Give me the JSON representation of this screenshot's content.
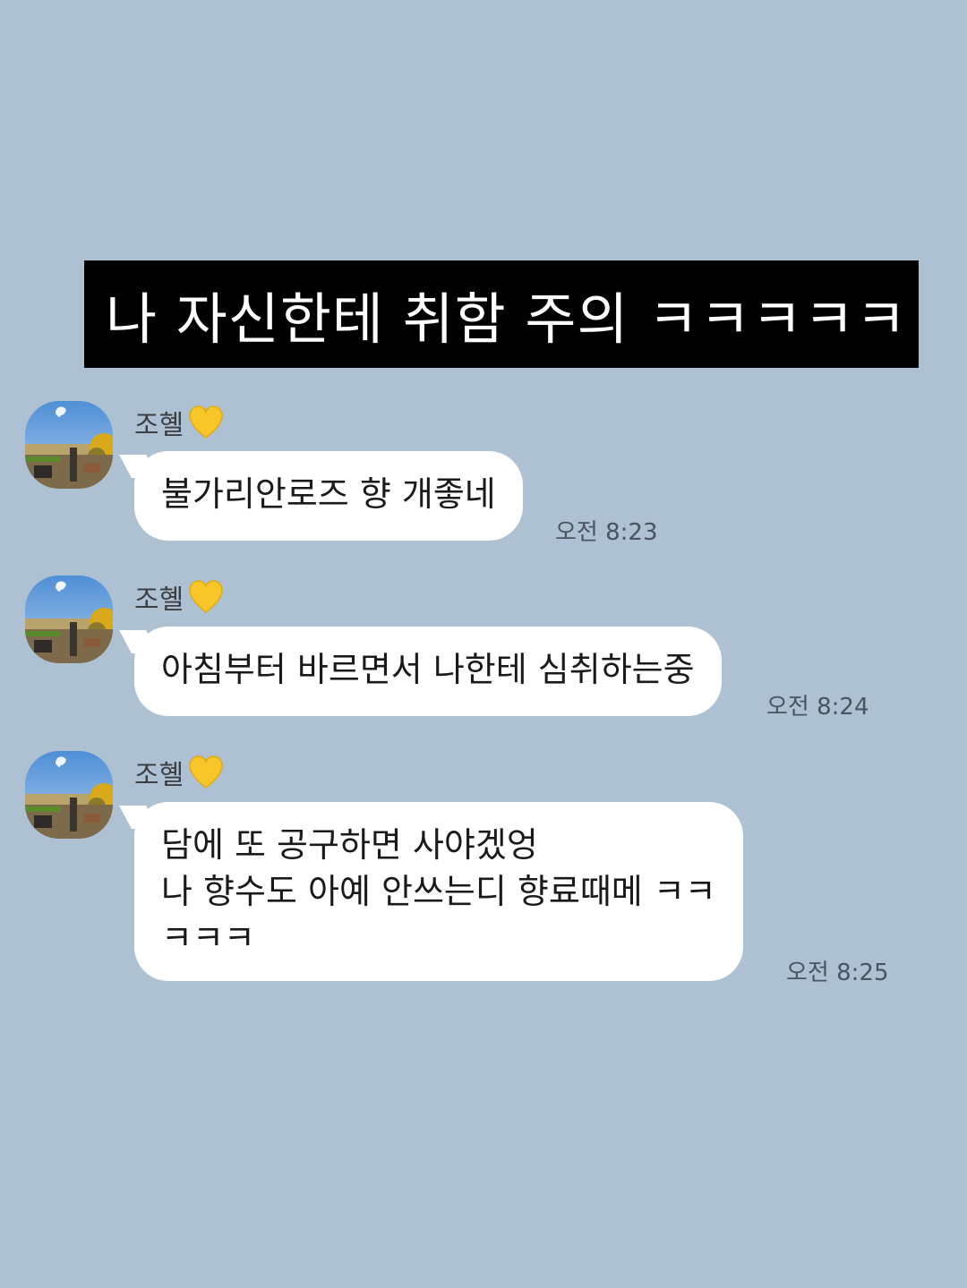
{
  "caption": "나 자신한테 취함 주의 ㅋㅋㅋㅋㅋ",
  "colors": {
    "background": "#adc1d2",
    "bubble": "#ffffff",
    "caption_bg": "#000000",
    "caption_text": "#ffffff",
    "heart": "#f7c729"
  },
  "messages": [
    {
      "sender": "조혤",
      "sender_icon": "yellow-heart-icon",
      "avatar_icon": "profile-photo-avatar",
      "lines": [
        "불가리안로즈 향 개좋네"
      ],
      "time": "오전 8:23"
    },
    {
      "sender": "조혤",
      "sender_icon": "yellow-heart-icon",
      "avatar_icon": "profile-photo-avatar",
      "lines": [
        "아침부터 바르면서 나한테 심취하는중"
      ],
      "time": "오전 8:24"
    },
    {
      "sender": "조혤",
      "sender_icon": "yellow-heart-icon",
      "avatar_icon": "profile-photo-avatar",
      "lines": [
        "담에 또 공구하면 사야겠엉",
        "나 향수도 아예 안쓰는디 향료때메 ㅋㅋ",
        "ㅋㅋㅋ"
      ],
      "time": "오전 8:25"
    }
  ]
}
